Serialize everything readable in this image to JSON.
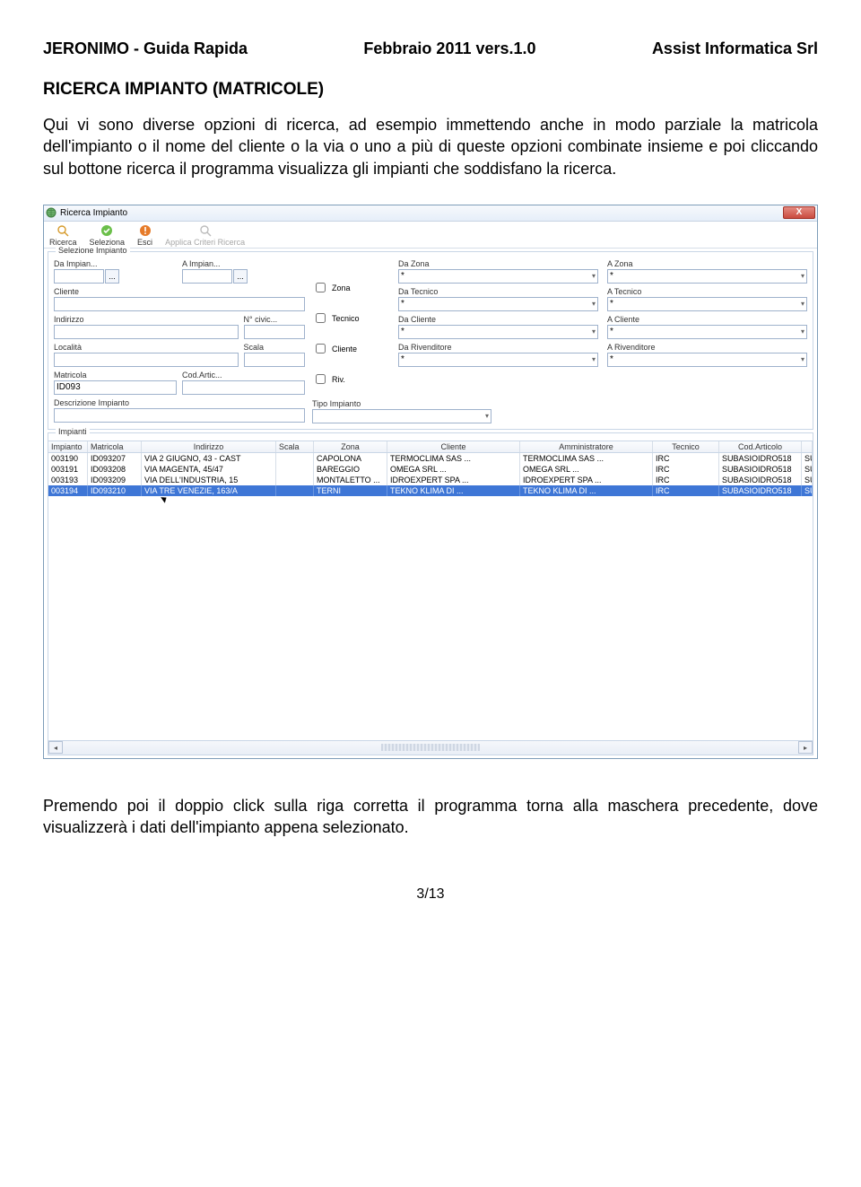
{
  "header": {
    "left": "JERONIMO - Guida Rapida",
    "mid": "Febbraio 2011 vers.1.0",
    "right": "Assist Informatica Srl"
  },
  "section_title": "RICERCA IMPIANTO (MATRICOLE)",
  "paragraph1": "Qui vi sono diverse opzioni di ricerca, ad esempio immettendo anche in modo parziale la matricola dell'impianto o il nome del cliente o la via o uno a più di queste opzioni combinate insieme e poi cliccando sul bottone ricerca il programma visualizza gli impianti che soddisfano la ricerca.",
  "paragraph2": "Premendo poi il doppio click sulla riga corretta il programma torna alla maschera precedente, dove visualizzerà i dati dell'impianto appena selezionato.",
  "pager": "3/13",
  "app": {
    "title": "Ricerca Impianto",
    "close": "X",
    "toolbar": {
      "search": "Ricerca",
      "select": "Seleziona",
      "exit": "Esci",
      "apply": "Applica Criteri Ricerca"
    },
    "group1_legend": "Selezione Impianto",
    "labels": {
      "da_imp": "Da Impian...",
      "a_imp": "A Impian...",
      "cliente": "Cliente",
      "indirizzo": "Indirizzo",
      "ncivic": "N° civic...",
      "localita": "Località",
      "scala": "Scala",
      "matricola": "Matricola",
      "codartic": "Cod.Artic...",
      "descr": "Descrizione Impianto",
      "tipo_imp": "Tipo Impianto",
      "zona_cb": "Zona",
      "tecnico_cb": "Tecnico",
      "cliente_cb": "Cliente",
      "riv_cb": "Riv.",
      "da_zona": "Da Zona",
      "a_zona": "A Zona",
      "da_tecnico": "Da Tecnico",
      "a_tecnico": "A Tecnico",
      "da_cliente": "Da Cliente",
      "a_cliente": "A Cliente",
      "da_riv": "Da Rivenditore",
      "a_riv": "A Rivenditore"
    },
    "values": {
      "matricola": "ID093"
    },
    "combo_default": "*",
    "dots": "...",
    "group2_legend": "Impianti",
    "columns": {
      "impianto": "Impianto",
      "matricola": "Matricola",
      "indirizzo": "Indirizzo",
      "scala": "Scala",
      "zona": "Zona",
      "cliente": "Cliente",
      "amministratore": "Amministratore",
      "tecnico": "Tecnico",
      "codart": "Cod.Articolo",
      "ext": ""
    },
    "rows": [
      {
        "imp": "003190",
        "mat": "ID093207",
        "ind": "VIA 2 GIUGNO, 43 - CAST",
        "sca": "",
        "zon": "CAPOLONA",
        "cli": "TERMOCLIMA SAS",
        "cli2": "...",
        "amm": "TERMOCLIMA SAS",
        "amm2": "...",
        "tec": "IRC",
        "cod": "SUBASIOIDRO518",
        "ext": "SUBASIO"
      },
      {
        "imp": "003191",
        "mat": "ID093208",
        "ind": "VIA MAGENTA, 45/47",
        "sca": "",
        "zon": "BAREGGIO",
        "cli": "OMEGA SRL",
        "cli2": "...",
        "amm": "OMEGA SRL",
        "amm2": "...",
        "tec": "IRC",
        "cod": "SUBASIOIDRO518",
        "ext": "SUBASIO"
      },
      {
        "imp": "003193",
        "mat": "ID093209",
        "ind": "VIA DELL'INDUSTRIA, 15",
        "sca": "",
        "zon": "MONTALETTO ...",
        "cli": "IDROEXPERT SPA",
        "cli2": "...",
        "amm": "IDROEXPERT SPA",
        "amm2": "...",
        "tec": "IRC",
        "cod": "SUBASIOIDRO518",
        "ext": "SUBASIO"
      },
      {
        "imp": "003194",
        "mat": "ID093210",
        "ind": "VIA TRE VENEZIE, 163/A",
        "sca": "",
        "zon": "TERNI",
        "cli": "TEKNO KLIMA",
        "cli2": "DI ...",
        "amm": "TEKNO KLIMA",
        "amm2": "DI ...",
        "tec": "IRC",
        "cod": "SUBASIOIDRO518",
        "ext": "SUBASIO"
      }
    ],
    "selected_row": 3
  }
}
